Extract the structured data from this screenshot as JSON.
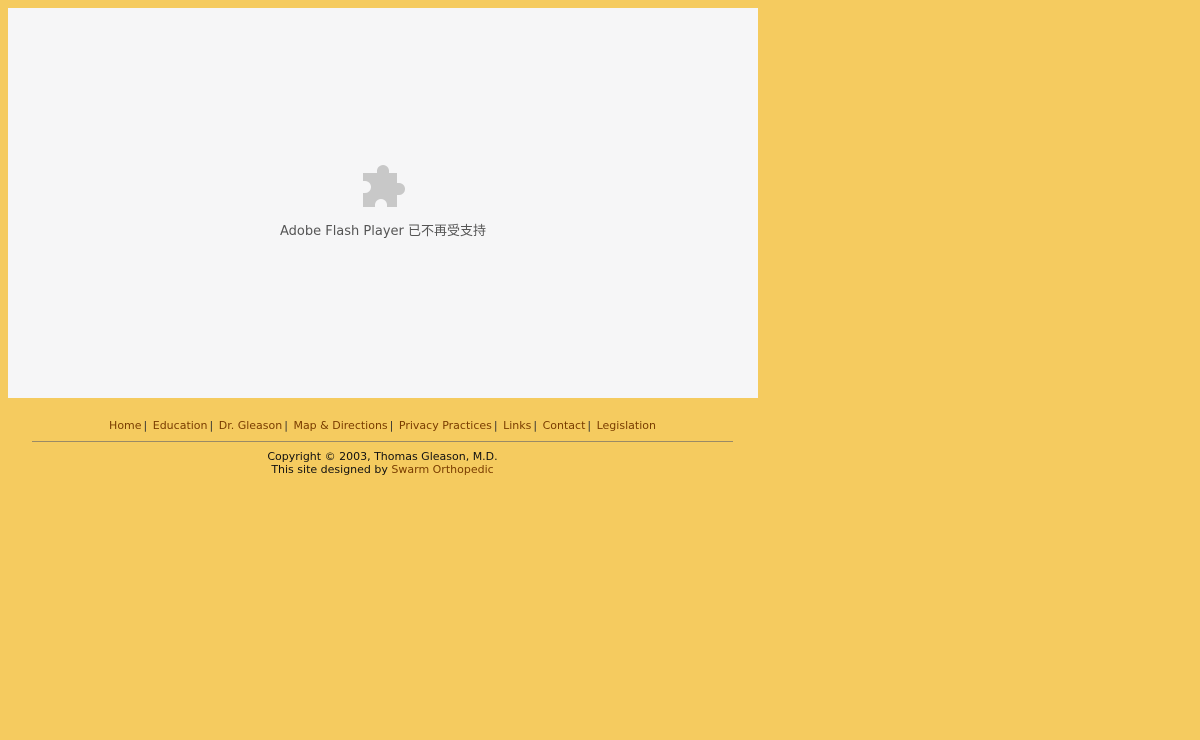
{
  "flash": {
    "message": "Adobe Flash Player 已不再受支持",
    "icon": "puzzle-piece-icon"
  },
  "nav": {
    "items": [
      {
        "label": "Home"
      },
      {
        "label": "Education"
      },
      {
        "label": "Dr. Gleason"
      },
      {
        "label": "Map & Directions"
      },
      {
        "label": "Privacy Practices"
      },
      {
        "label": "Links"
      },
      {
        "label": "Contact"
      },
      {
        "label": "Legislation"
      }
    ],
    "separator": "|"
  },
  "footer": {
    "copyright": "Copyright © 2003, Thomas Gleason, M.D.",
    "designed_by_prefix": "This site designed by",
    "designer_link": "Swarm Orthopedic"
  },
  "colors": {
    "background": "#f5cb5f",
    "flash_box": "#f6f6f7",
    "link": "#7a3d00"
  }
}
